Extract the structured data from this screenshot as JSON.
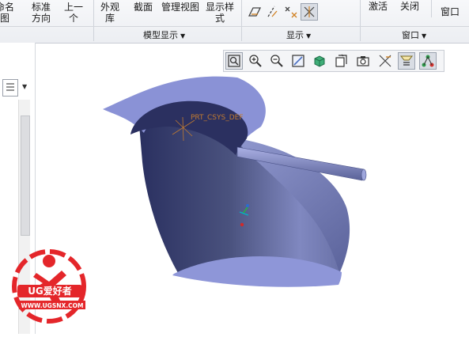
{
  "ribbon": {
    "buttons": [
      {
        "id": "rename",
        "lines": [
          "命名",
          "图"
        ]
      },
      {
        "id": "standard-orient",
        "lines": [
          "标准",
          "方向"
        ]
      },
      {
        "id": "previous",
        "lines": [
          "上一",
          "个"
        ]
      },
      {
        "id": "appearance",
        "lines": [
          "外观",
          "库"
        ]
      },
      {
        "id": "section",
        "lines": [
          "截面",
          ""
        ]
      },
      {
        "id": "manage-views",
        "lines": [
          "管理视图",
          ""
        ]
      },
      {
        "id": "display-style",
        "lines": [
          "显示样",
          "式"
        ]
      },
      {
        "id": "activate",
        "lines": [
          "激活",
          ""
        ]
      },
      {
        "id": "close",
        "lines": [
          "关闭",
          ""
        ]
      },
      {
        "id": "window",
        "lines": [
          "窗口",
          ""
        ]
      }
    ],
    "groups": [
      {
        "id": "model-display",
        "label": "模型显示"
      },
      {
        "id": "display",
        "label": "显示"
      },
      {
        "id": "window",
        "label": "窗口"
      }
    ],
    "display_icons": [
      "plane-display-icon",
      "axis-display-icon",
      "point-display-icon",
      "csys-display-icon"
    ]
  },
  "view_toolbar": {
    "buttons": [
      "refit-icon",
      "zoom-in-icon",
      "zoom-out-icon",
      "repaint-icon",
      "saved-orientations-icon",
      "display-style-icon",
      "view-manager-icon",
      "annotation-display-icon",
      "datum-display-icon",
      "spin-center-icon"
    ]
  },
  "viewport": {
    "csys_label": "PRT_CSYS_DEF",
    "model_color": "#7c84c8"
  },
  "watermark": {
    "brand": "UG爱好者",
    "url": "WWW.UGSNX.COM"
  }
}
